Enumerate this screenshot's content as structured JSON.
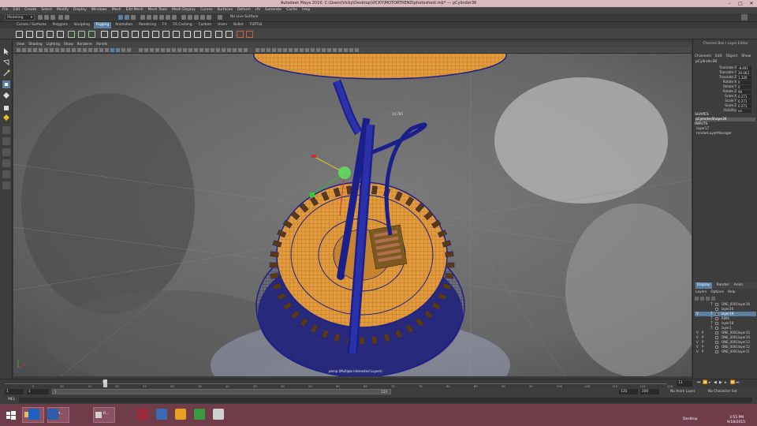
{
  "window": {
    "title": "Autodesk Maya 2016: C:\\Users\\Vicky\\Desktop\\VICKY\\MOTORTREND\\photoshoot.mb* --- pCylinder36",
    "minimize": "–",
    "maximize": "□",
    "close": "✕"
  },
  "menubar": [
    "File",
    "Edit",
    "Create",
    "Select",
    "Modify",
    "Display",
    "Windows",
    "Mesh",
    "Edit Mesh",
    "Mesh Tools",
    "Mesh Display",
    "Curves",
    "Surfaces",
    "Deform",
    "UV",
    "Generate",
    "Cache",
    "Help"
  ],
  "status_line": {
    "mode": "Modeling",
    "live_surface": "No Live Surface"
  },
  "shelf": {
    "tabs": [
      "Curves / Surfaces",
      "Polygons",
      "Sculpting",
      "Rigging",
      "Animation",
      "Rendering",
      "FX",
      "FX Caching",
      "Custom",
      "Users",
      "Bullet",
      "TURTLE"
    ],
    "active_tab": "Rigging"
  },
  "panel_menu": [
    "View",
    "Shading",
    "Lighting",
    "Show",
    "Renderer",
    "Panels"
  ],
  "viewport": {
    "camera_label": "persp (Multiple Interested Layers)",
    "hud_label": "14.785"
  },
  "channel_box": {
    "header": "Channel Box / Layer Editor",
    "menu": [
      "Channels",
      "Edit",
      "Object",
      "Show"
    ],
    "object_name": "pCylinder36",
    "attributes": [
      {
        "label": "Translate X",
        "value": "-8.401"
      },
      {
        "label": "Translate Y",
        "value": "20.063"
      },
      {
        "label": "Translate Z",
        "value": "1.326"
      },
      {
        "label": "Rotate X",
        "value": "0"
      },
      {
        "label": "Rotate Y",
        "value": "0"
      },
      {
        "label": "Rotate Z",
        "value": "90"
      },
      {
        "label": "Scale X",
        "value": "0.271"
      },
      {
        "label": "Scale Y",
        "value": "0.271"
      },
      {
        "label": "Scale Z",
        "value": "0.271"
      },
      {
        "label": "Visibility",
        "value": "on"
      }
    ],
    "shapes_header": "SHAPES",
    "shape_name": "pCylinderShape36",
    "inputs_header": "INPUTS",
    "inputs": [
      "layer17",
      "renderLayerManager"
    ]
  },
  "layer_editor": {
    "tabs": [
      "Display",
      "Render",
      "Anim"
    ],
    "active_tab": "Display",
    "menu": [
      "Layers",
      "Options",
      "Help"
    ],
    "layers": [
      {
        "v": "",
        "p": "",
        "t": "T",
        "name": "ONE_0001layer16",
        "color": "#3c3c3c",
        "selected": false
      },
      {
        "v": "",
        "p": "",
        "t": "",
        "name": "layer20",
        "color": "#3c3c3c",
        "selected": false
      },
      {
        "v": "V",
        "p": "",
        "t": "T",
        "name": "layer19",
        "color": "#3c3c3c",
        "selected": true
      },
      {
        "v": "",
        "p": "",
        "t": "T",
        "name": "RIM4",
        "color": "#b01616",
        "selected": false
      },
      {
        "v": "",
        "p": "",
        "t": "T",
        "name": "layer18",
        "color": "#3c3c3c",
        "selected": false
      },
      {
        "v": "",
        "p": "",
        "t": "T",
        "name": "layer1",
        "color": "#3c3c3c",
        "selected": false
      },
      {
        "v": "V",
        "p": "P",
        "t": "",
        "name": "ONE_0001layer15",
        "color": "#3c3c3c",
        "selected": false
      },
      {
        "v": "V",
        "p": "P",
        "t": "",
        "name": "ONE_0001layer14",
        "color": "#3c3c3c",
        "selected": false
      },
      {
        "v": "V",
        "p": "P",
        "t": "",
        "name": "ONE_0001layer13",
        "color": "#3c3c3c",
        "selected": false
      },
      {
        "v": "V",
        "p": "P",
        "t": "",
        "name": "ONE_0001layer12",
        "color": "#3c3c3c",
        "selected": false
      },
      {
        "v": "V",
        "p": "P",
        "t": "",
        "name": "ONE_0001layer11",
        "color": "#3c3c3c",
        "selected": false
      }
    ]
  },
  "time_slider": {
    "ticks": [
      "5",
      "10",
      "15",
      "20",
      "25",
      "30",
      "35",
      "40",
      "45",
      "50",
      "55",
      "60",
      "65",
      "70",
      "75",
      "80",
      "85",
      "90",
      "95",
      "100",
      "105",
      "110",
      "115",
      "120"
    ],
    "current_frame": "13",
    "current_frame_field": "13"
  },
  "range_slider": {
    "start": "1",
    "inner_start": "1",
    "range_start": "1",
    "range_end": "120",
    "end": "120",
    "max": "200",
    "anim_layer": "No Anim Layer",
    "char_set": "No Character Set"
  },
  "command_line": {
    "label": "MEL"
  },
  "taskbar": {
    "time": "3:55 PM",
    "date": "9/18/2015",
    "desktop_label": "Desktop",
    "items": [
      {
        "label": "O...",
        "icon": "folder-icon"
      },
      {
        "label": "H...",
        "icon": "app-icon"
      },
      {
        "label": "R...",
        "icon": "app-icon"
      }
    ]
  },
  "colors": {
    "wire_blue": "#1a1f8c",
    "orange": "#e39a3c",
    "highlight": "#5b7fa0",
    "taskbar": "#6f3c4a"
  }
}
